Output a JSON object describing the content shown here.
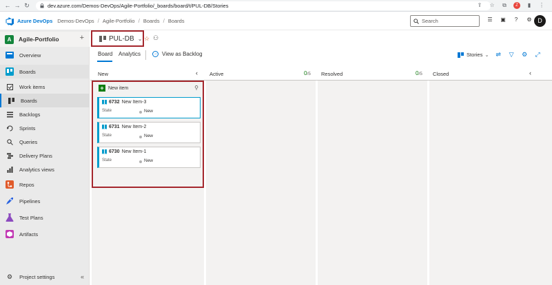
{
  "browser": {
    "url": "dev.azure.com/Demos-DevOps/Agile-Portfolio/_boards/board/t/PUL-DB/Stories",
    "profile_initial": "Z"
  },
  "header": {
    "brand": "Azure DevOps",
    "breadcrumbs": [
      "Demos-DevOps",
      "Agile-Portfolio",
      "Boards",
      "Boards"
    ],
    "search_placeholder": "Search",
    "avatar_initial": "D"
  },
  "sidebar": {
    "project_initial": "A",
    "project_name": "Agile-Portfolio",
    "items": [
      {
        "label": "Overview"
      },
      {
        "label": "Boards"
      },
      {
        "label": "Work items"
      },
      {
        "label": "Boards"
      },
      {
        "label": "Backlogs"
      },
      {
        "label": "Sprints"
      },
      {
        "label": "Queries"
      },
      {
        "label": "Delivery Plans"
      },
      {
        "label": "Analytics views"
      },
      {
        "label": "Repos"
      },
      {
        "label": "Pipelines"
      },
      {
        "label": "Test Plans"
      },
      {
        "label": "Artifacts"
      }
    ],
    "settings_label": "Project settings"
  },
  "board": {
    "name": "PUL-DB",
    "pivots": [
      "Board",
      "Analytics"
    ],
    "view_as_backlog": "View as Backlog",
    "backlog_level": "Stories"
  },
  "columns": [
    {
      "name": "New"
    },
    {
      "name": "Active",
      "count": "0",
      "max": "/5"
    },
    {
      "name": "Resolved",
      "count": "0",
      "max": "/5"
    },
    {
      "name": "Closed"
    }
  ],
  "new_item_label": "New item",
  "cards": [
    {
      "id": "6732",
      "title": "New Item-3",
      "state_label": "State",
      "state": "New"
    },
    {
      "id": "6731",
      "title": "New Item-2",
      "state_label": "State",
      "state": "New"
    },
    {
      "id": "6730",
      "title": "New Item-1",
      "state_label": "State",
      "state": "New"
    }
  ],
  "colors": {
    "accent": "#0078d4",
    "highlight_border": "#a4262c",
    "story_blue": "#009ccc",
    "add_green": "#107c10"
  }
}
